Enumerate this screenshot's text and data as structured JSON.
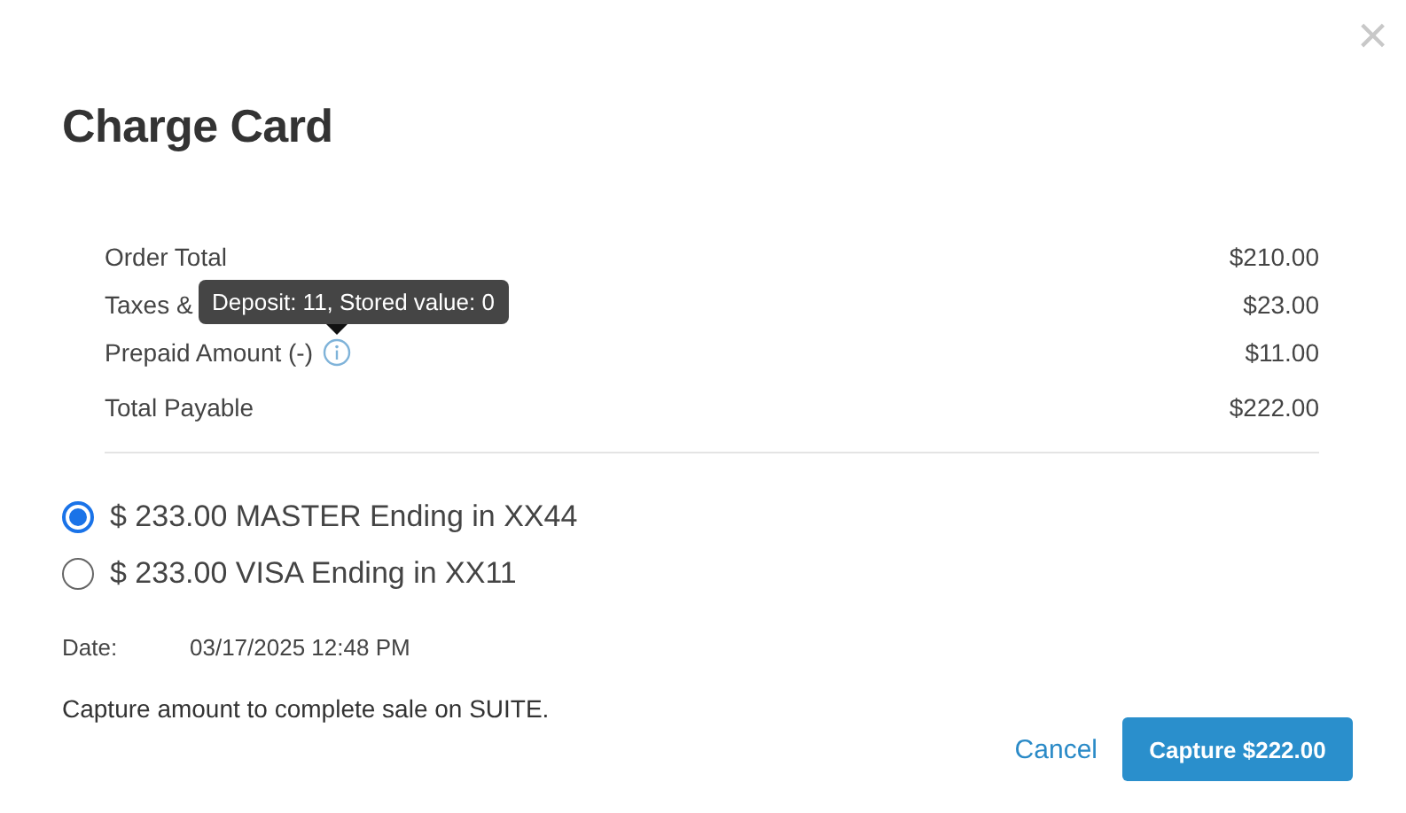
{
  "dialog": {
    "title": "Charge Card",
    "close": "×"
  },
  "summary": [
    {
      "label": "Order Total",
      "value": "$210.00"
    },
    {
      "label": "Taxes &",
      "value": "$23.00"
    },
    {
      "label": "Prepaid Amount (-)",
      "value": "$11.00",
      "info": true,
      "tooltip": "Deposit: 11, Stored value: 0"
    },
    {
      "label": "Total Payable",
      "value": "$222.00"
    }
  ],
  "cards": [
    {
      "label": "$ 233.00 MASTER Ending in XX44",
      "selected": true
    },
    {
      "label": "$ 233.00 VISA Ending in XX11",
      "selected": false
    }
  ],
  "date": {
    "label": "Date:",
    "value": "03/17/2025 12:48 PM"
  },
  "note": "Capture amount to complete sale on SUITE.",
  "buttons": {
    "cancel": "Cancel",
    "capture": "Capture $222.00"
  }
}
